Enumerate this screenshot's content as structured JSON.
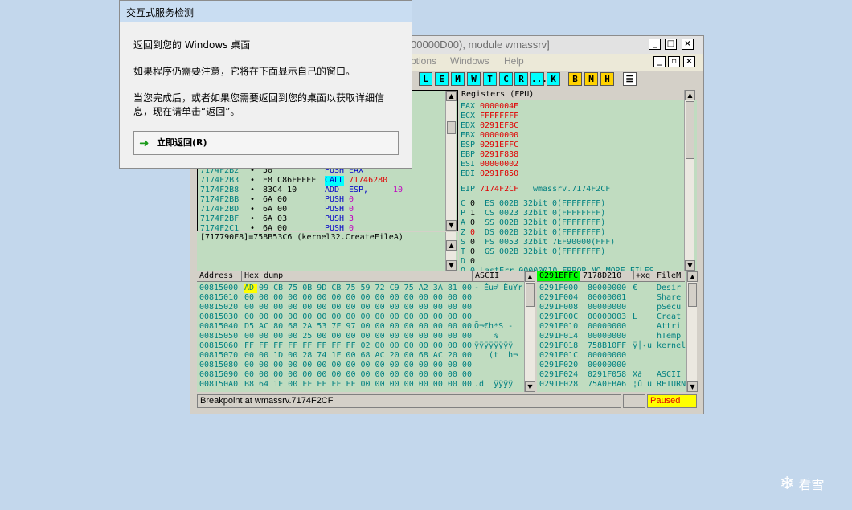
{
  "window": {
    "title": "00000D00), module wmassrv]"
  },
  "menus": [
    "ptions",
    "Windows",
    "Help"
  ],
  "toolbar": {
    "cyan": [
      "L",
      "E",
      "M",
      "W",
      "T",
      "C",
      "R",
      "...",
      "K"
    ],
    "yellow": [
      "B",
      "M",
      "H"
    ]
  },
  "disasm": {
    "rows": [
      {
        "addr": "7174F2B2",
        "dot": "•",
        "hex": "50",
        "op": "PUSH",
        "arg": "EAX",
        "argColor": "blue",
        "hl": false
      },
      {
        "addr": "7174F2B3",
        "dot": "•",
        "hex": "E8 C86FFFFF",
        "op": "CALL",
        "arg": "71746280",
        "argColor": "red",
        "hl": true
      },
      {
        "addr": "7174F2B8",
        "dot": "•",
        "hex": "83C4 10",
        "op": "ADD",
        "arg": "ESP,",
        "arg2": "10",
        "argColor": "blue",
        "hl": false
      },
      {
        "addr": "7174F2BB",
        "dot": "•",
        "hex": "6A 00",
        "op": "PUSH",
        "arg": "0",
        "argColor": "mag",
        "hl": false
      },
      {
        "addr": "7174F2BD",
        "dot": "•",
        "hex": "6A 00",
        "op": "PUSH",
        "arg": "0",
        "argColor": "mag",
        "hl": false
      },
      {
        "addr": "7174F2BF",
        "dot": "•",
        "hex": "6A 03",
        "op": "PUSH",
        "arg": "3",
        "argColor": "mag",
        "hl": false
      },
      {
        "addr": "7174F2C1",
        "dot": "•",
        "hex": "6A 00",
        "op": "PUSH",
        "arg": "0",
        "argColor": "mag",
        "hl": false
      }
    ],
    "info": "[717790F8]=758B53C6 (kernel32.CreateFileA)"
  },
  "registers": {
    "header": "Registers (FPU)",
    "regs": [
      [
        "EAX",
        "0000004E"
      ],
      [
        "ECX",
        "FFFFFFFF"
      ],
      [
        "EDX",
        "0291EF8C"
      ],
      [
        "EBX",
        "00000000"
      ],
      [
        "ESP",
        "0291EFFC"
      ],
      [
        "EBP",
        "0291F838"
      ],
      [
        "ESI",
        "00000002"
      ],
      [
        "EDI",
        "0291F850"
      ]
    ],
    "eip": [
      "EIP",
      "7174F2CF",
      "wmassrv.7174F2CF"
    ],
    "flags": [
      [
        "C",
        "0",
        "ES",
        "002B",
        "32bit",
        "0(FFFFFFFF)"
      ],
      [
        "P",
        "1",
        "CS",
        "0023",
        "32bit",
        "0(FFFFFFFF)"
      ],
      [
        "A",
        "0",
        "SS",
        "002B",
        "32bit",
        "0(FFFFFFFF)"
      ],
      [
        "Z",
        "0",
        "DS",
        "002B",
        "32bit",
        "0(FFFFFFFF)"
      ],
      [
        "S",
        "0",
        "FS",
        "0053",
        "32bit",
        "7EF90000(FFF)"
      ],
      [
        "T",
        "0",
        "GS",
        "002B",
        "32bit",
        "0(FFFFFFFF)"
      ],
      [
        "D",
        "0",
        "",
        "",
        "",
        ""
      ]
    ],
    "lasterr": "O 0 LastErr 00000010 ERROR_NO_MORE_FILES"
  },
  "dump": {
    "headers": {
      "address": "Address",
      "hex": "Hex dump",
      "ascii": "ASCII"
    },
    "rows": [
      {
        "addr": "00815000",
        "hex": "AD 09 CB 75 0B 9D CB 75 59 72 C9 75 A2 3A 81 00",
        "ascii": "- Éu♂ ÈuYr"
      },
      {
        "addr": "00815010",
        "hex": "00 00 00 00 00 00 00 00 00 00 00 00 00 00 00 00",
        "ascii": ""
      },
      {
        "addr": "00815020",
        "hex": "00 00 00 00 00 00 00 00 00 00 00 00 00 00 00 00",
        "ascii": ""
      },
      {
        "addr": "00815030",
        "hex": "00 00 00 00 00 00 00 00 00 00 00 00 00 00 00 00",
        "ascii": ""
      },
      {
        "addr": "00815040",
        "hex": "D5 AC 80 68 2A 53 7F 97 00 00 00 00 00 00 00 00",
        "ascii": "Õ¬€h*S -"
      },
      {
        "addr": "00815050",
        "hex": "00 00 00 00 25 00 00 00 00 00 00 00 00 00 00 00",
        "ascii": "    %"
      },
      {
        "addr": "00815060",
        "hex": "FF FF FF FF FF FF FF FF 02 00 00 00 00 00 00 00",
        "ascii": "ÿÿÿÿÿÿÿÿ"
      },
      {
        "addr": "00815070",
        "hex": "00 00 1D 00 28 74 1F 00 68 AC 20 00 68 AC 20 00",
        "ascii": "   (t  h¬"
      },
      {
        "addr": "00815080",
        "hex": "00 00 00 00 00 00 00 00 00 00 00 00 00 00 00 00",
        "ascii": ""
      },
      {
        "addr": "00815090",
        "hex": "00 00 00 00 00 00 00 00 00 00 00 00 00 00 00 00",
        "ascii": ""
      },
      {
        "addr": "008150A0",
        "hex": "B8 64 1F 00 FF FF FF FF 00 00 00 00 00 00 00 00",
        "ascii": ".d  ÿÿÿÿ"
      }
    ]
  },
  "stack": {
    "h1": "0291EFFC",
    "h2": "7178D210",
    "h3": "┼+xq",
    "h4": "FileM",
    "rows": [
      [
        "0291F000",
        "80000000",
        "€",
        "Desir"
      ],
      [
        "0291F004",
        "00000001",
        "",
        "Share"
      ],
      [
        "0291F008",
        "00000000",
        "",
        "pSecu"
      ],
      [
        "0291F00C",
        "00000003",
        "L",
        "Creat"
      ],
      [
        "0291F010",
        "00000000",
        "",
        "Attri"
      ],
      [
        "0291F014",
        "00000000",
        "",
        "hTemp"
      ],
      [
        "0291F018",
        "758B10FF",
        "ÿ┤‹u",
        "kernel"
      ],
      [
        "0291F01C",
        "00000000",
        "",
        ""
      ],
      [
        "0291F020",
        "00000000",
        "",
        ""
      ],
      [
        "0291F024",
        "0291F058",
        "X∂",
        "ASCII"
      ],
      [
        "0291F028",
        "75A0FBA6",
        "¦û u",
        "RETURN"
      ]
    ]
  },
  "status": {
    "text": "Breakpoint at wmassrv.7174F2CF",
    "state": "Paused"
  },
  "dialog": {
    "title": "交互式服务检测",
    "line1": "返回到您的 Windows 桌面",
    "line2": "如果程序仍需要注意，它将在下面显示自己的窗口。",
    "line3": "当您完成后，或者如果您需要返回到您的桌面以获取详细信",
    "line4": "息，现在请单击“返回”。",
    "button": "立即返回(R)"
  },
  "watermark": "看雪"
}
